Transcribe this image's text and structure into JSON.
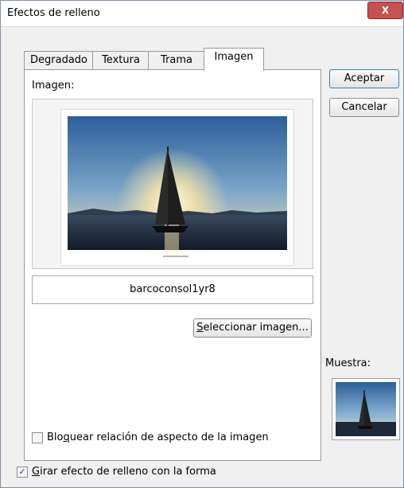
{
  "window": {
    "title": "Efectos de relleno",
    "close_glyph": "X"
  },
  "tabs": [
    {
      "label": "Degradado",
      "active": false
    },
    {
      "label": "Textura",
      "active": false
    },
    {
      "label": "Trama",
      "active": false
    },
    {
      "label": "Imagen",
      "active": true
    }
  ],
  "imagen_panel": {
    "image_label": "Imagen:",
    "filename": "barcoconsol1yr8",
    "select_image_button": {
      "before": "",
      "accel": "S",
      "after": "eleccionar imagen..."
    },
    "lock_aspect": {
      "checked": false,
      "before": "Blo",
      "accel": "q",
      "after": "uear relación de aspecto de la imagen"
    }
  },
  "rotate_with_shape": {
    "checked": true,
    "before": "",
    "accel": "G",
    "after": "irar efecto de relleno con la forma"
  },
  "buttons": {
    "accept": "Aceptar",
    "cancel": "Cancelar"
  },
  "sample": {
    "label": "Muestra:"
  },
  "colors": {
    "accent": "#1f4fa6",
    "close_button": "#c75050"
  }
}
